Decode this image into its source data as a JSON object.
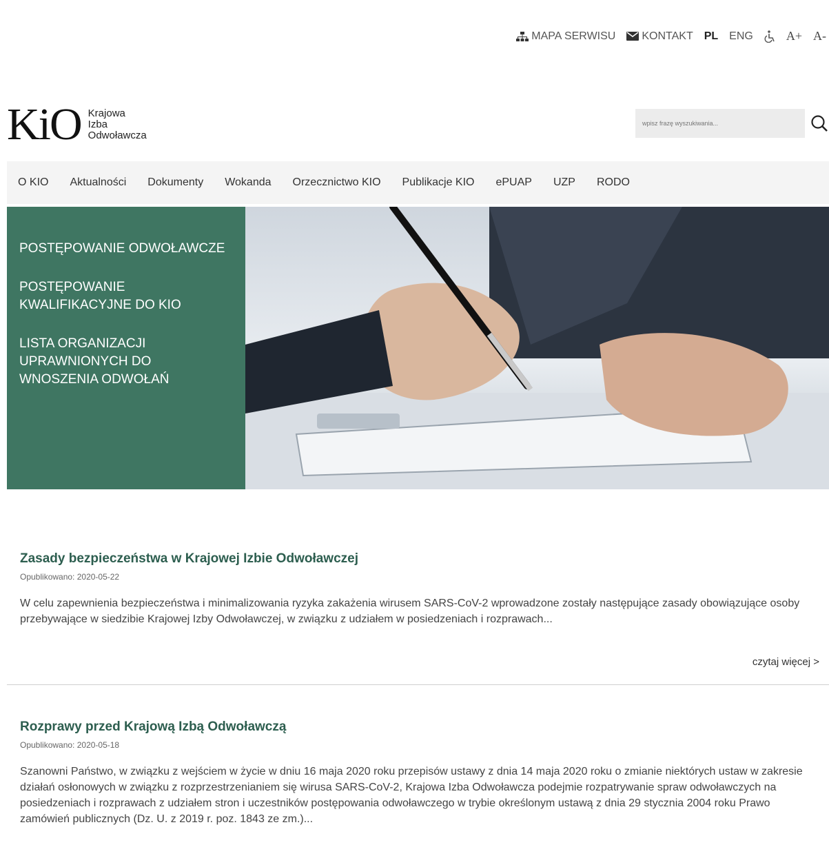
{
  "utility": {
    "sitemap": "MAPA SERWISU",
    "contact": "KONTAKT",
    "lang_pl": "PL",
    "lang_eng": "ENG",
    "font_plus": "A+",
    "font_minus": "A-"
  },
  "logo": {
    "mark": "KiO",
    "line1": "Krajowa",
    "line2": "Izba",
    "line3": "Odwoławcza"
  },
  "search": {
    "placeholder": "wpisz frazę wyszukiwania..."
  },
  "nav": {
    "items": [
      "O KIO",
      "Aktualności",
      "Dokumenty",
      "Wokanda",
      "Orzecznictwo KIO",
      "Publikacje KIO",
      "ePUAP",
      "UZP",
      "RODO"
    ]
  },
  "hero": {
    "menu": [
      "POSTĘPOWANIE ODWOŁAWCZE",
      "POSTĘPOWANIE KWALIFIKACYJNE DO KIO",
      "LISTA ORGANIZACJI UPRAWNIONYCH DO WNOSZENIA ODWOŁAŃ"
    ]
  },
  "articles": [
    {
      "title": "Zasady bezpieczeństwa w Krajowej Izbie Odwoławczej",
      "date": "Opublikowano: 2020-05-22",
      "excerpt": "W celu zapewnienia bezpieczeństwa i minimalizowania ryzyka zakażenia wirusem SARS-CoV-2 wprowadzone zostały następujące zasady obowiązujące osoby przebywające w siedzibie Krajowej Izby Odwoławczej, w związku z udziałem w posiedzeniach i rozprawach...",
      "readmore": "czytaj więcej >"
    },
    {
      "title": "Rozprawy przed Krajową Izbą Odwoławczą",
      "date": "Opublikowano: 2020-05-18",
      "excerpt": "Szanowni Państwo, w związku z wejściem w życie w dniu 16 maja 2020 roku przepisów ustawy z dnia 14 maja 2020 roku o zmianie niektórych ustaw w zakresie działań osłonowych w związku z rozprzestrzenianiem się wirusa SARS-CoV-2, Krajowa Izba Odwoławcza podejmie rozpatrywanie spraw odwoławczych na posiedzeniach i rozprawach z udziałem stron i uczestników postępowania odwoławczego w trybie określonym ustawą z dnia 29 stycznia 2004 roku Prawo zamówień publicznych (Dz. U. z 2019 r. poz. 1843 ze zm.)..."
    }
  ],
  "colors": {
    "brand_green": "#3f7662",
    "title_green": "#2d5e4f"
  }
}
